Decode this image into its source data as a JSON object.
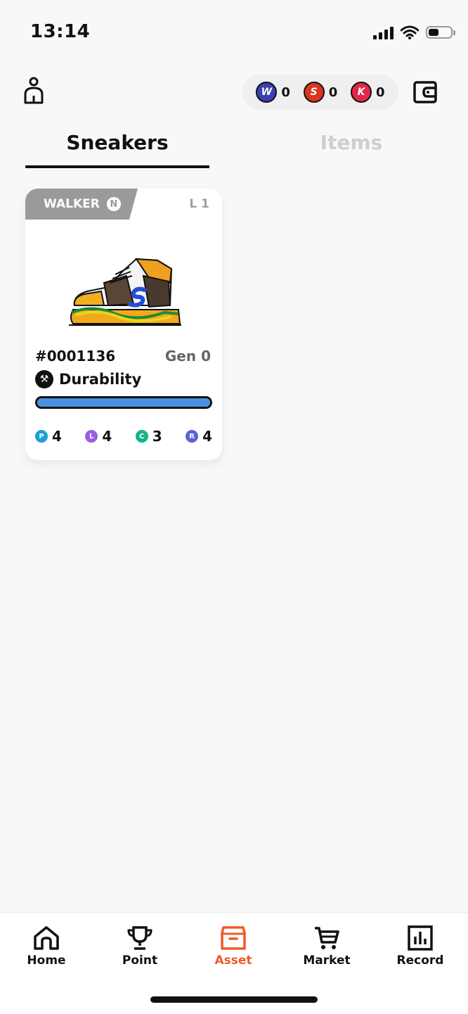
{
  "status_bar": {
    "time": "13:14",
    "battery_level": 0.45
  },
  "header": {
    "tokens": [
      {
        "name": "walk-token",
        "glyph": "W",
        "amount": "0",
        "color": "#3a3fb8"
      },
      {
        "name": "s-token",
        "glyph": "S",
        "amount": "0",
        "color": "#d9361f"
      },
      {
        "name": "k-token",
        "glyph": "K",
        "amount": "0",
        "color": "#e0284a"
      }
    ]
  },
  "tabs": {
    "sneakers": "Sneakers",
    "items": "Items",
    "active": "sneakers"
  },
  "card": {
    "type_label": "WALKER",
    "rarity": "N",
    "level": "L 1",
    "id": "#0001136",
    "gen": "Gen 0",
    "durability_label": "Durability",
    "durability_fraction": 1.0,
    "stats": [
      {
        "key": "P",
        "value": "4",
        "color": "#1a9fd6"
      },
      {
        "key": "L",
        "value": "4",
        "color": "#9b5de5"
      },
      {
        "key": "C",
        "value": "3",
        "color": "#14b38a"
      },
      {
        "key": "R",
        "value": "4",
        "color": "#5b63d6"
      }
    ]
  },
  "nav": {
    "items": [
      {
        "label": "Home",
        "icon": "home-icon"
      },
      {
        "label": "Point",
        "icon": "trophy-icon"
      },
      {
        "label": "Asset",
        "icon": "box-icon"
      },
      {
        "label": "Market",
        "icon": "cart-icon"
      },
      {
        "label": "Record",
        "icon": "bar-chart-icon"
      }
    ],
    "active": "Asset",
    "active_color": "#f05a28"
  }
}
